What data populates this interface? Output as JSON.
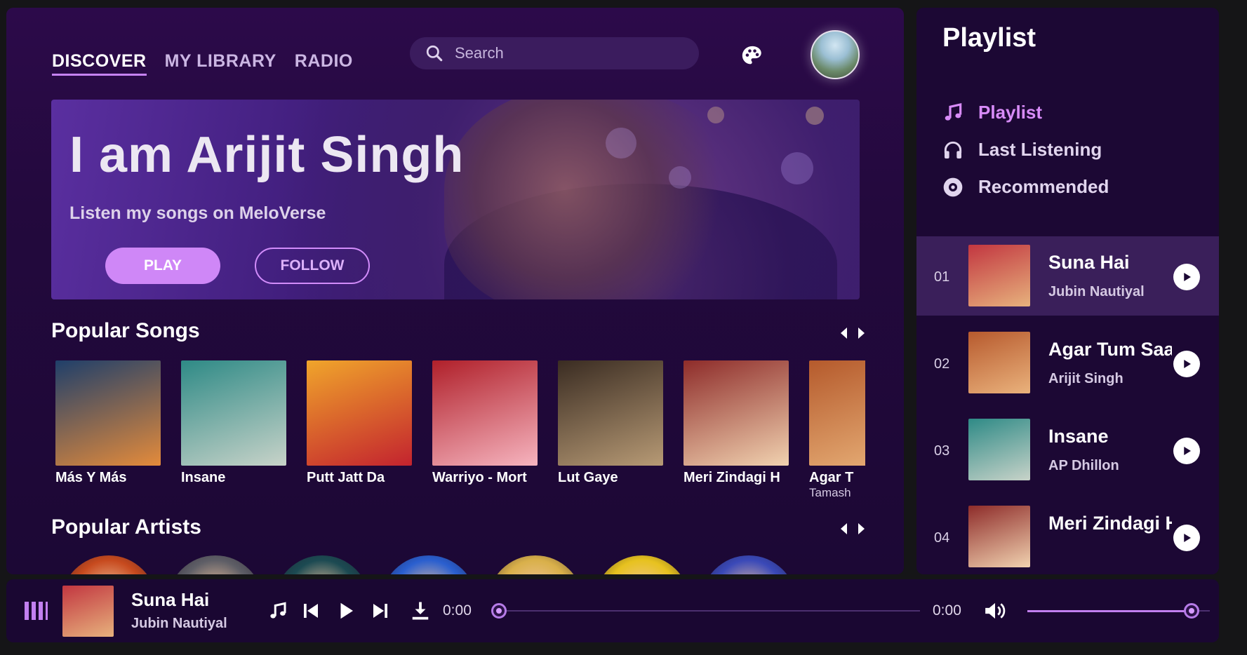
{
  "nav": {
    "tabs": [
      {
        "label": "DISCOVER",
        "active": true
      },
      {
        "label": "MY LIBRARY",
        "active": false
      },
      {
        "label": "RADIO",
        "active": false
      }
    ],
    "search_placeholder": "Search"
  },
  "hero": {
    "title": "I am Arijit Singh",
    "subtitle": "Listen my songs on MeloVerse",
    "play_label": "PLAY",
    "follow_label": "FOLLOW"
  },
  "popular_songs": {
    "title": "Popular Songs",
    "items": [
      {
        "title": "Más Y Más",
        "subtitle": "",
        "cover": [
          "#1f3f6a",
          "#e48b3b"
        ]
      },
      {
        "title": "Insane",
        "subtitle": "",
        "cover": [
          "#2e8a86",
          "#c8d3c9"
        ]
      },
      {
        "title": "Putt Jatt Da",
        "subtitle": "",
        "cover": [
          "#f0a52b",
          "#c3232e"
        ]
      },
      {
        "title": "Warriyo - Mort",
        "subtitle": "",
        "cover": [
          "#b0202a",
          "#f6b4bf"
        ]
      },
      {
        "title": "Lut Gaye",
        "subtitle": "",
        "cover": [
          "#3a2c22",
          "#b79a75"
        ]
      },
      {
        "title": "Meri Zindagi H",
        "subtitle": "",
        "cover": [
          "#8e2c2a",
          "#f1d2b0"
        ]
      },
      {
        "title": "Agar T",
        "subtitle": "Tamash",
        "cover": [
          "#b55a2c",
          "#e9b27a"
        ]
      }
    ]
  },
  "popular_artists": {
    "title": "Popular Artists",
    "items": [
      {
        "color": "#c74a1e"
      },
      {
        "color": "#5e5e66"
      },
      {
        "color": "#1c4a52"
      },
      {
        "color": "#2a5fcf"
      },
      {
        "color": "#d9b04a"
      },
      {
        "color": "#e7c21f"
      },
      {
        "color": "#3a49b8"
      }
    ]
  },
  "sidebar": {
    "title": "Playlist",
    "menu": [
      {
        "label": "Playlist",
        "icon": "music-note-icon",
        "active": true
      },
      {
        "label": "Last Listening",
        "icon": "headphones-icon",
        "active": false
      },
      {
        "label": "Recommended",
        "icon": "disc-icon",
        "active": false
      }
    ],
    "tracks": [
      {
        "num": "01",
        "title": "Suna Hai",
        "artist": "Jubin Nautiyal",
        "active": true,
        "cover": [
          "#c23640",
          "#e7b27d"
        ]
      },
      {
        "num": "02",
        "title": "Agar Tum Saath Ho",
        "artist": "Arijit Singh",
        "active": false,
        "cover": [
          "#b75a2e",
          "#eab27c"
        ]
      },
      {
        "num": "03",
        "title": "Insane",
        "artist": "AP Dhillon",
        "active": false,
        "cover": [
          "#2e8a86",
          "#c8d3c9"
        ]
      },
      {
        "num": "04",
        "title": "Meri Zindagi Hai Tu",
        "artist": "",
        "active": false,
        "cover": [
          "#8e2c2a",
          "#f1d2b0"
        ]
      }
    ]
  },
  "player": {
    "title": "Suna Hai",
    "artist": "Jubin Nautiyal",
    "current_time": "0:00",
    "duration": "0:00",
    "progress": 0,
    "volume": 0.9,
    "cover": [
      "#c23640",
      "#e7b27d"
    ]
  },
  "colors": {
    "accent": "#cf87f7",
    "background": "#151517",
    "panel": "#22093c"
  }
}
